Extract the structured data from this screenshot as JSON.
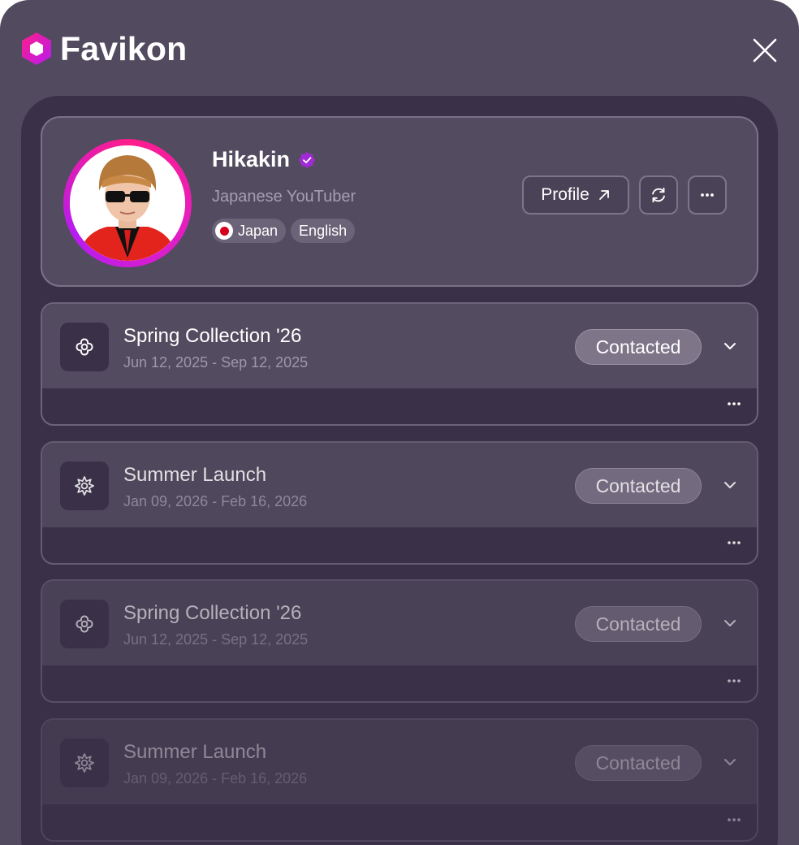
{
  "app": {
    "name": "Favikon",
    "logo_icon": "hexagon-logo-icon",
    "close_icon": "close-icon"
  },
  "colors": {
    "background": "#524a5f",
    "panel": "#3a3148",
    "card": "#534b5f",
    "brand_gradient": [
      "#ff1d8a",
      "#b61cf0"
    ]
  },
  "profile": {
    "name": "Hikakin",
    "verified_icon": "verified-badge-icon",
    "subtitle": "Japanese YouTuber",
    "tags": [
      {
        "label": "Japan",
        "icon": "japan-flag-icon"
      },
      {
        "label": "English"
      }
    ],
    "buttons": {
      "profile_label": "Profile",
      "profile_icon": "arrow-up-right-icon",
      "refresh_icon": "refresh-icon",
      "more_icon": "more-horizontal-icon"
    }
  },
  "campaigns": [
    {
      "title": "Spring Collection '26",
      "dates": "Jun 12, 2025 - Sep 12, 2025",
      "status": "Contacted",
      "icon": "flower-icon"
    },
    {
      "title": "Summer Launch",
      "dates": "Jan 09, 2026 - Feb 16, 2026",
      "status": "Contacted",
      "icon": "sun-icon"
    },
    {
      "title": "Spring Collection '26",
      "dates": "Jun 12, 2025 - Sep 12, 2025",
      "status": "Contacted",
      "icon": "flower-icon"
    },
    {
      "title": "Summer Launch",
      "dates": "Jan 09, 2026 - Feb 16, 2026",
      "status": "Contacted",
      "icon": "sun-icon"
    }
  ]
}
